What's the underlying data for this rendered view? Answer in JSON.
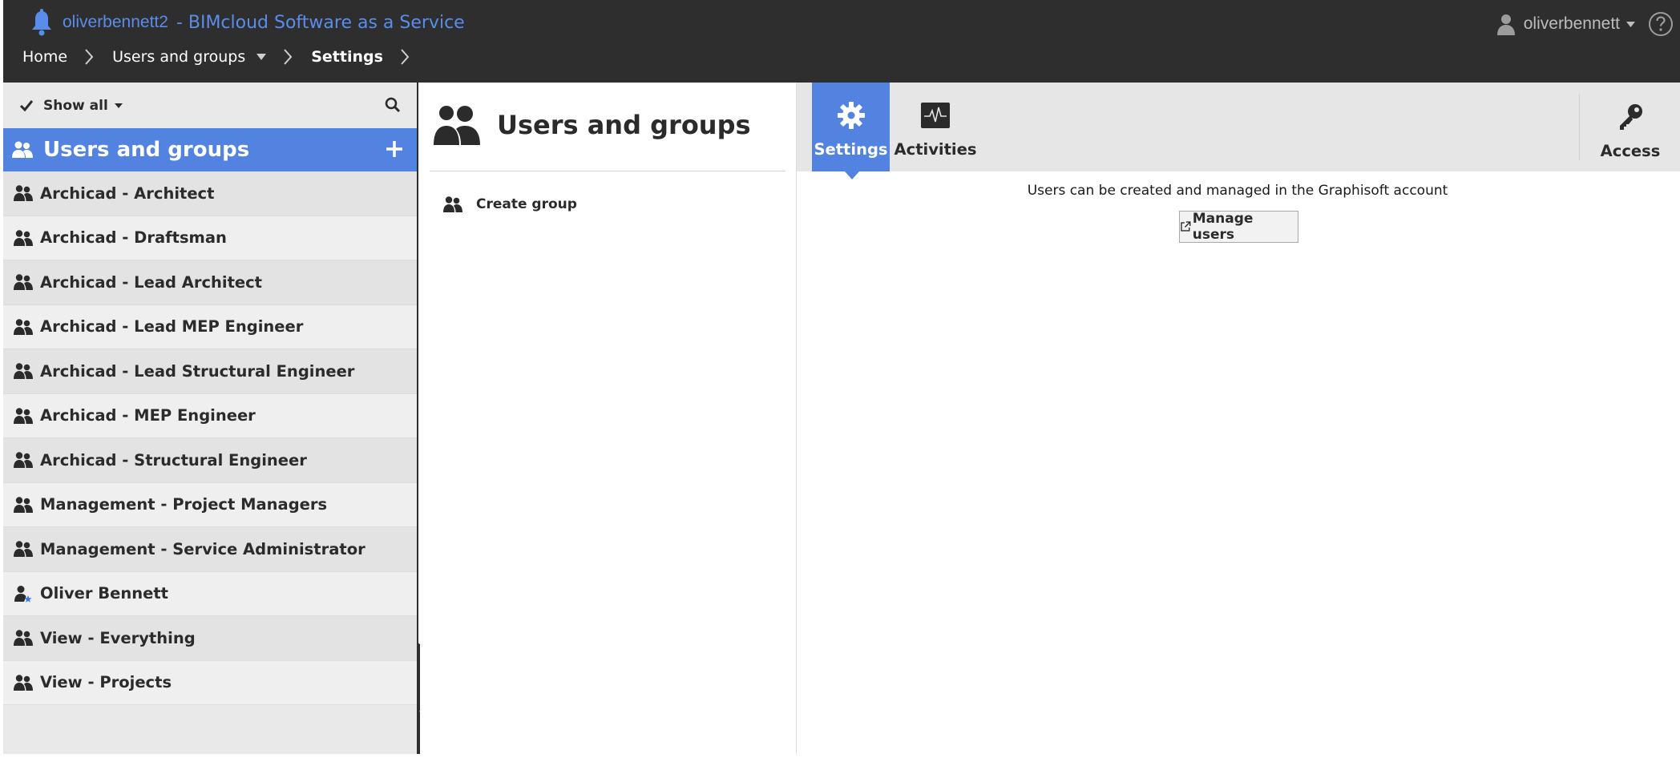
{
  "topbar": {
    "account": "oliverbennett2",
    "app_title": "- BIMcloud Software as a Service",
    "user_menu": "oliverbennett"
  },
  "breadcrumb": {
    "home": "Home",
    "users_and_groups": "Users and groups",
    "settings": "Settings"
  },
  "sidebar": {
    "filter_label": "Show all",
    "header_title": "Users and groups",
    "items": [
      {
        "label": "Archicad - Architect",
        "icon": "group-icon"
      },
      {
        "label": "Archicad - Draftsman",
        "icon": "group-icon"
      },
      {
        "label": "Archicad - Lead Architect",
        "icon": "group-icon"
      },
      {
        "label": "Archicad - Lead MEP Engineer",
        "icon": "group-icon"
      },
      {
        "label": "Archicad - Lead Structural Engineer",
        "icon": "group-icon"
      },
      {
        "label": "Archicad - MEP Engineer",
        "icon": "group-icon"
      },
      {
        "label": "Archicad - Structural Engineer",
        "icon": "group-icon"
      },
      {
        "label": "Management - Project Managers",
        "icon": "group-icon"
      },
      {
        "label": "Management - Service Administrator",
        "icon": "group-icon"
      },
      {
        "label": "Oliver Bennett",
        "icon": "admin-user-icon"
      },
      {
        "label": "View - Everything",
        "icon": "group-icon"
      },
      {
        "label": "View - Projects",
        "icon": "group-icon"
      }
    ]
  },
  "middle": {
    "title": "Users and groups",
    "create_group": "Create group"
  },
  "right": {
    "tabs": {
      "settings": "Settings",
      "activities": "Activities",
      "access": "Access"
    },
    "info_text": "Users can be created and managed in the Graphisoft account",
    "manage_users": "Manage users"
  },
  "colors": {
    "accent": "#5283e0",
    "topbar_bg": "#2e2e2e",
    "brand_text": "#5a8dea"
  }
}
